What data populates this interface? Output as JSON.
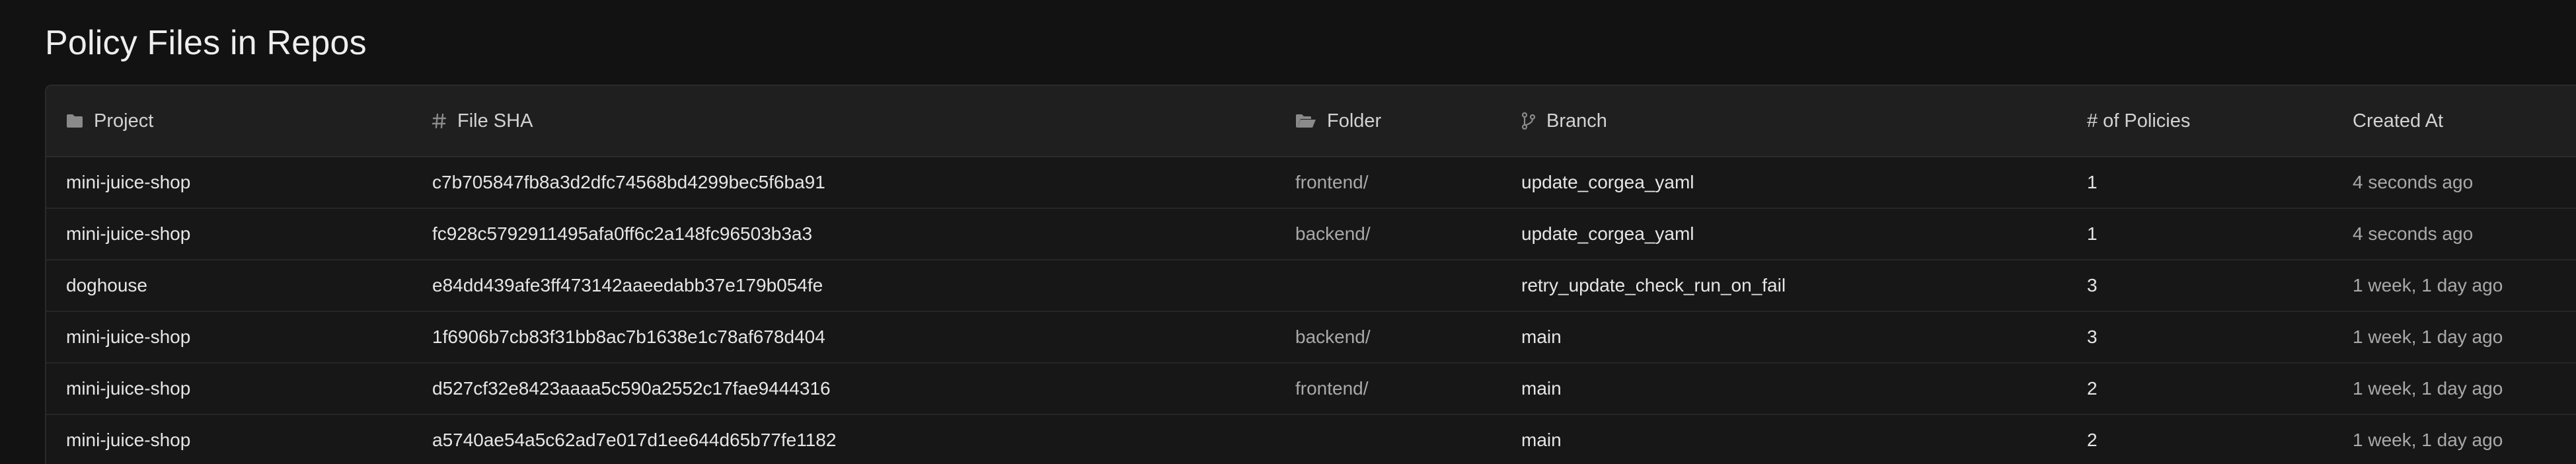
{
  "page": {
    "title": "Policy Files in Repos"
  },
  "table": {
    "columns": {
      "project": "Project",
      "file_sha": "File SHA",
      "folder": "Folder",
      "branch": "Branch",
      "policies": "# of Policies",
      "created_at": "Created At"
    },
    "rows": [
      {
        "project": "mini-juice-shop",
        "file_sha": "c7b705847fb8a3d2dfc74568bd4299bec5f6ba91",
        "folder": "frontend/",
        "branch": "update_corgea_yaml",
        "policies": "1",
        "created_at": "4 seconds ago"
      },
      {
        "project": "mini-juice-shop",
        "file_sha": "fc928c5792911495afa0ff6c2a148fc96503b3a3",
        "folder": "backend/",
        "branch": "update_corgea_yaml",
        "policies": "1",
        "created_at": "4 seconds ago"
      },
      {
        "project": "doghouse",
        "file_sha": "e84dd439afe3ff473142aaeedabb37e179b054fe",
        "folder": "",
        "branch": "retry_update_check_run_on_fail",
        "policies": "3",
        "created_at": "1 week, 1 day ago"
      },
      {
        "project": "mini-juice-shop",
        "file_sha": "1f6906b7cb83f31bb8ac7b1638e1c78af678d404",
        "folder": "backend/",
        "branch": "main",
        "policies": "3",
        "created_at": "1 week, 1 day ago"
      },
      {
        "project": "mini-juice-shop",
        "file_sha": "d527cf32e8423aaaa5c590a2552c17fae9444316",
        "folder": "frontend/",
        "branch": "main",
        "policies": "2",
        "created_at": "1 week, 1 day ago"
      },
      {
        "project": "mini-juice-shop",
        "file_sha": "a5740ae54a5c62ad7e017d1ee644d65b77fe1182",
        "folder": "",
        "branch": "main",
        "policies": "2",
        "created_at": "1 week, 1 day ago"
      }
    ]
  },
  "icons": {
    "project": "folder-icon",
    "file_sha": "hash-icon",
    "folder": "folder-open-icon",
    "branch": "git-branch-icon"
  },
  "colors": {
    "background": "#121212",
    "header_row": "#1f1f1f",
    "text_primary": "#e6e6e6",
    "text_muted": "#a9a9a9",
    "icon": "#8a8a8a"
  }
}
